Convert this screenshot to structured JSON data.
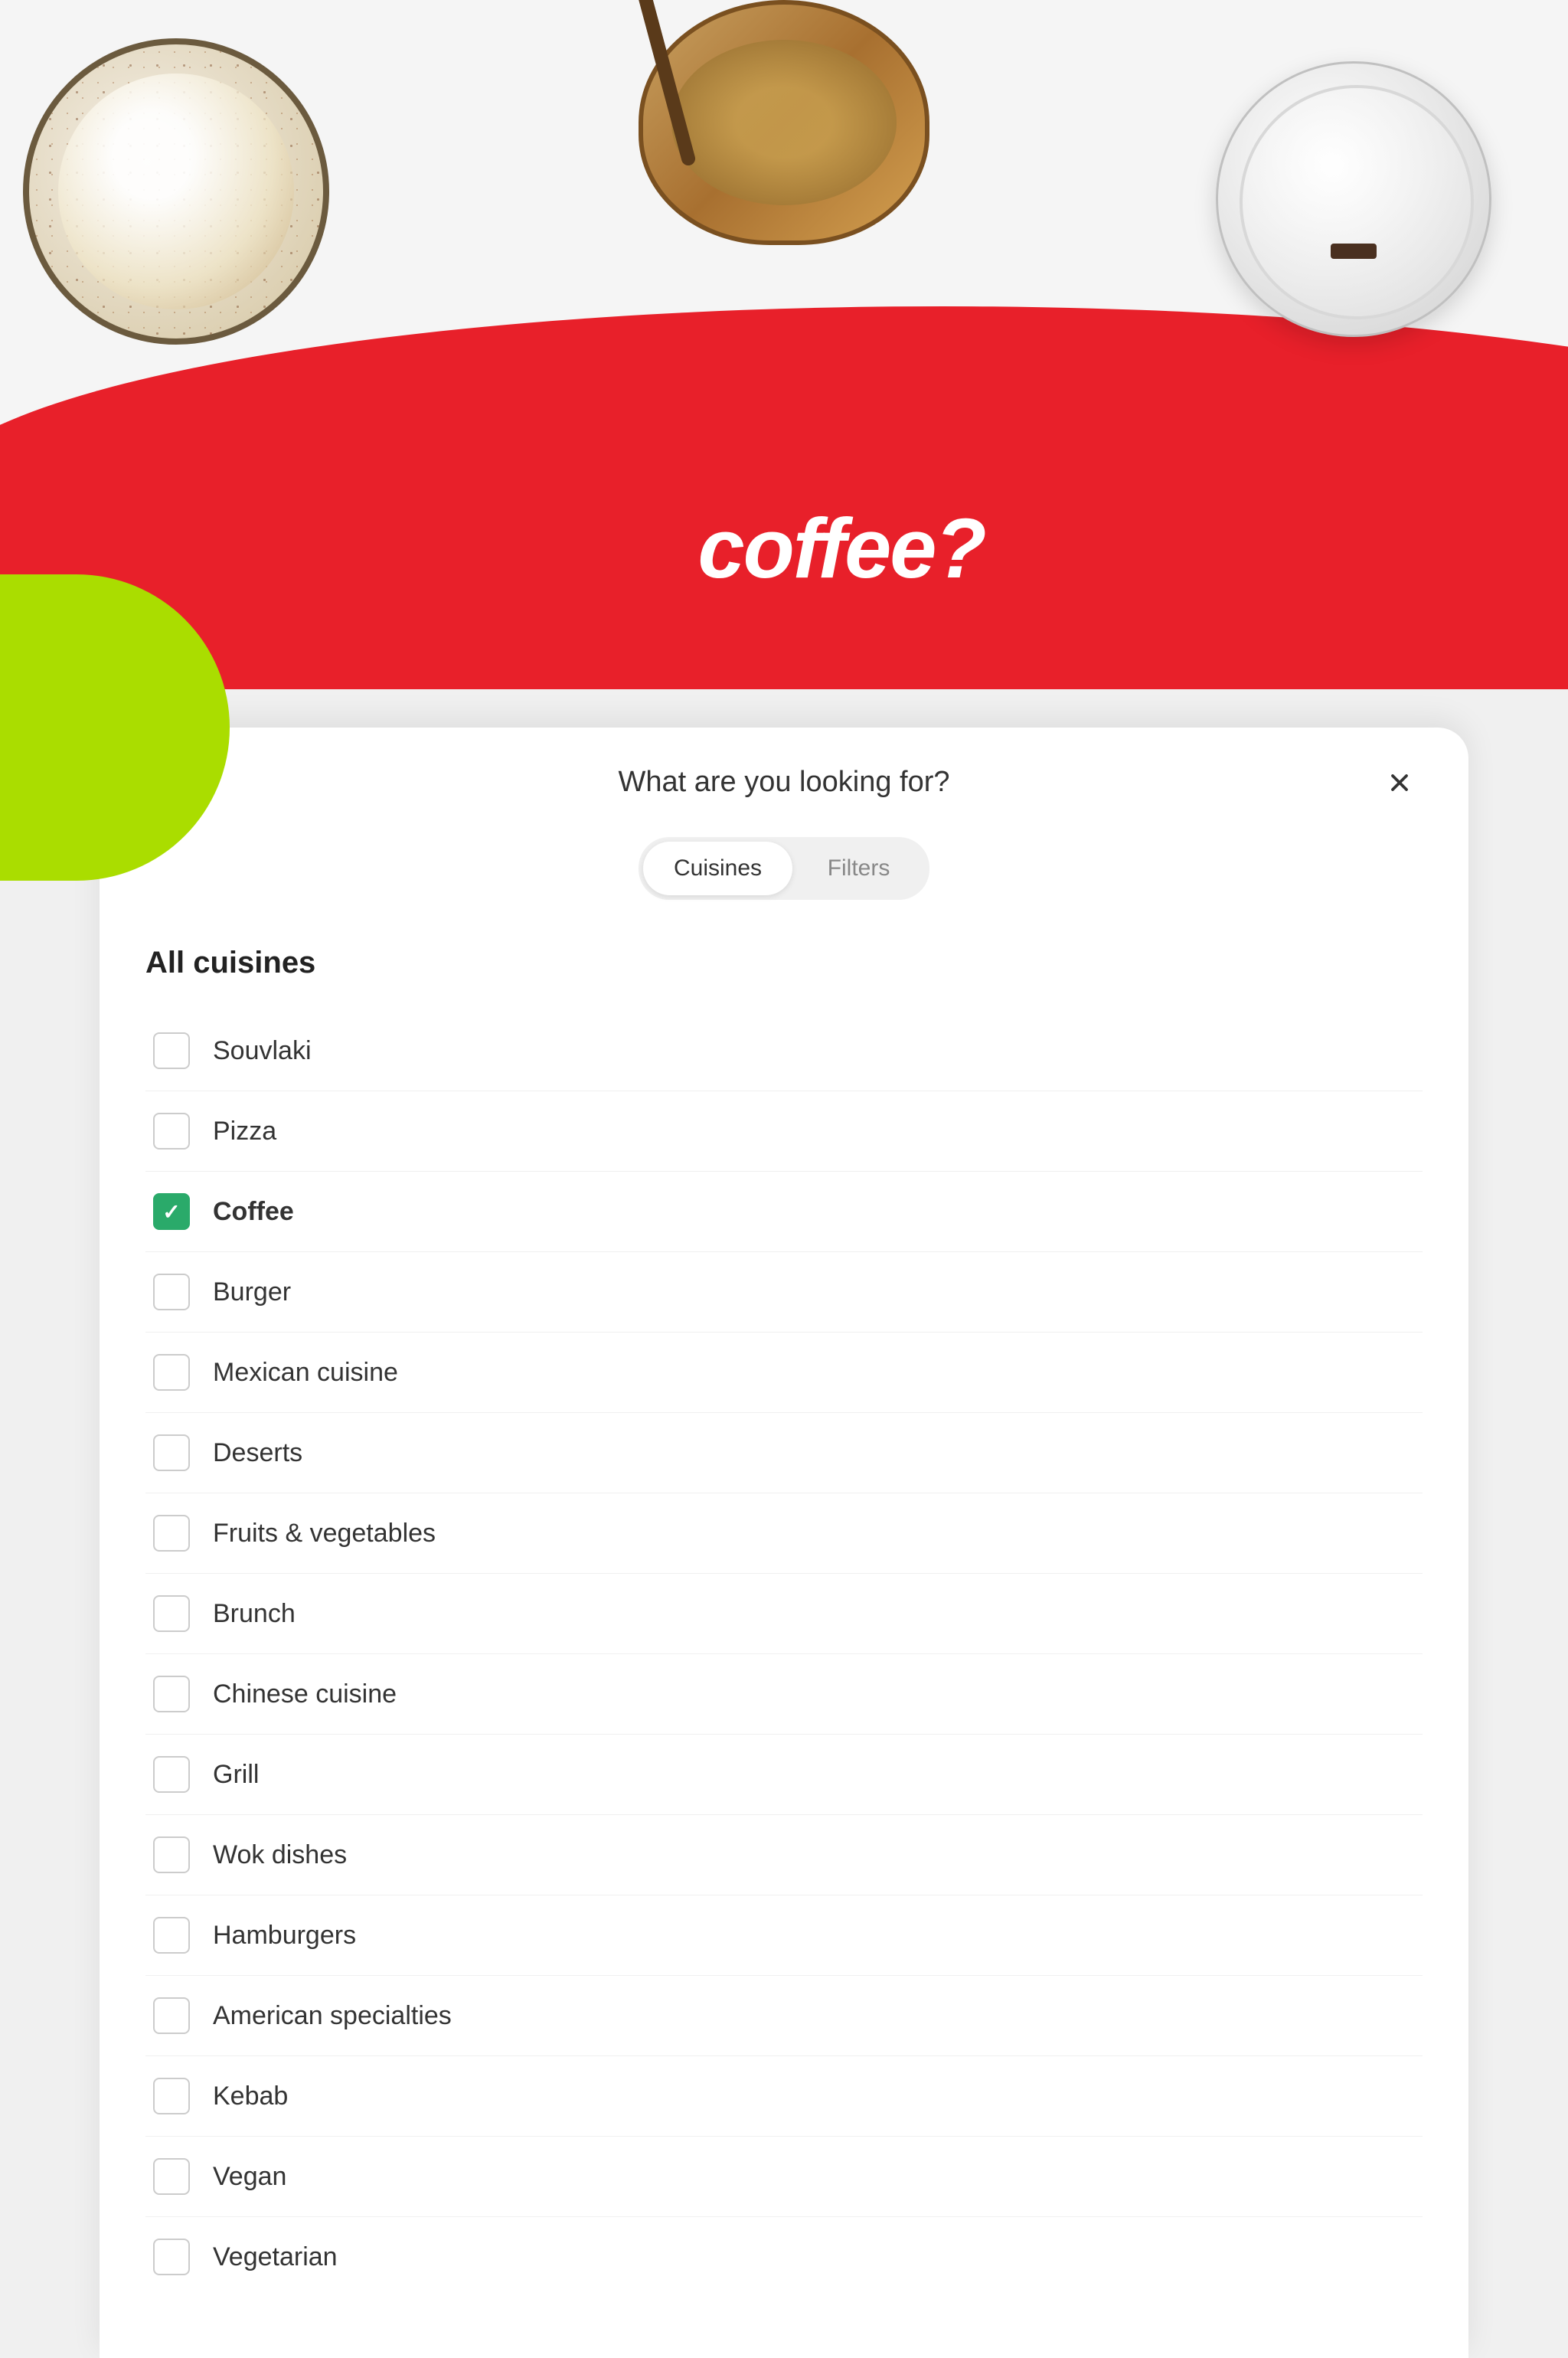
{
  "hero": {
    "coffee_text": "coffee?",
    "background_color": "#f5f5f5",
    "wave_color": "#e8202a",
    "green_color": "#aadd00"
  },
  "modal": {
    "title": "What are you looking for?",
    "close_label": "×",
    "tabs": [
      {
        "id": "cuisines",
        "label": "Cuisines",
        "active": true
      },
      {
        "id": "filters",
        "label": "Filters",
        "active": false
      }
    ],
    "section_heading": "All cuisines",
    "cuisine_items": [
      {
        "id": "souvlaki",
        "label": "Souvlaki",
        "checked": false
      },
      {
        "id": "pizza",
        "label": "Pizza",
        "checked": false
      },
      {
        "id": "coffee",
        "label": "Coffee",
        "checked": true
      },
      {
        "id": "burger",
        "label": "Burger",
        "checked": false
      },
      {
        "id": "mexican",
        "label": "Mexican cuisine",
        "checked": false
      },
      {
        "id": "deserts",
        "label": "Deserts",
        "checked": false
      },
      {
        "id": "fruits-veg",
        "label": "Fruits & vegetables",
        "checked": false
      },
      {
        "id": "brunch",
        "label": "Brunch",
        "checked": false
      },
      {
        "id": "chinese",
        "label": "Chinese cuisine",
        "checked": false
      },
      {
        "id": "grill",
        "label": "Grill",
        "checked": false
      },
      {
        "id": "wok",
        "label": "Wok dishes",
        "checked": false
      },
      {
        "id": "hamburgers",
        "label": "Hamburgers",
        "checked": false
      },
      {
        "id": "american",
        "label": "American specialties",
        "checked": false
      },
      {
        "id": "kebab",
        "label": "Kebab",
        "checked": false
      },
      {
        "id": "vegan",
        "label": "Vegan",
        "checked": false
      },
      {
        "id": "vegetarian",
        "label": "Vegetarian",
        "checked": false
      }
    ]
  }
}
